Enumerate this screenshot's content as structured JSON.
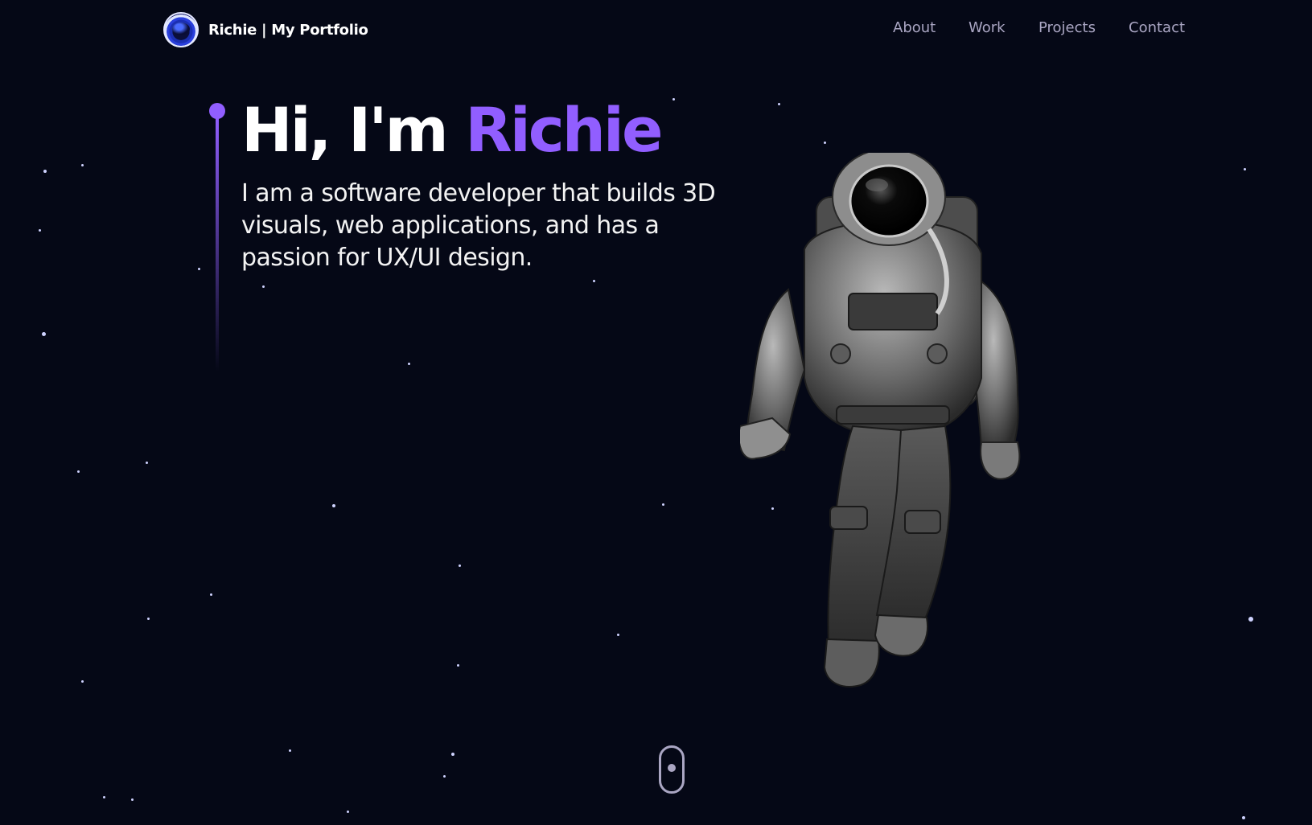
{
  "navbar": {
    "brand": "Richie | My Portfolio",
    "links": [
      "About",
      "Work",
      "Projects",
      "Contact"
    ]
  },
  "hero": {
    "greeting": "Hi, I'm ",
    "name": "Richie",
    "subtitle": "I am a software developer that builds 3D visuals, web applications, and has a passion for UX/UI design."
  },
  "icons": {
    "logo": "astronaut-helmet-icon",
    "scroll": "mouse-scroll-icon"
  },
  "colors": {
    "background": "#050816",
    "accent": "#915eff",
    "nav_text": "#aaa6c3",
    "text": "#ffffff"
  }
}
